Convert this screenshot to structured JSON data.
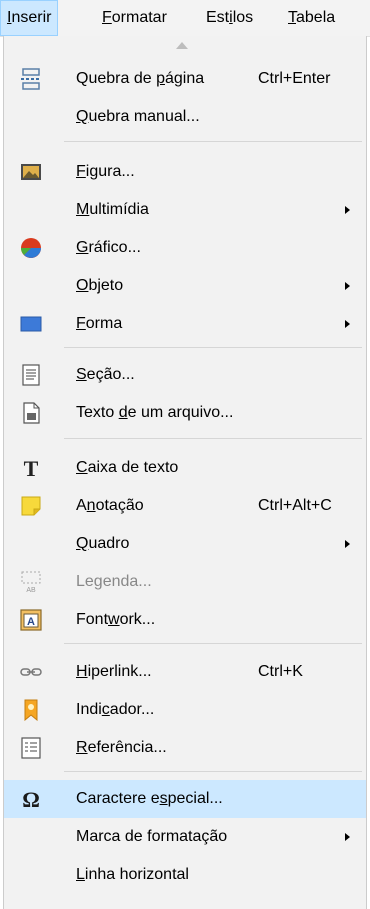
{
  "menubar": {
    "items": [
      {
        "pre": "",
        "u": "I",
        "post": "nserir",
        "active": true
      },
      {
        "pre": "",
        "u": "F",
        "post": "ormatar",
        "active": false
      },
      {
        "pre": "Est",
        "u": "i",
        "post": "los",
        "active": false
      },
      {
        "pre": "",
        "u": "T",
        "post": "abela",
        "active": false
      }
    ]
  },
  "menu": {
    "items": [
      {
        "pre": "Quebra de ",
        "u": "p",
        "post": "ágina",
        "shortcut": "Ctrl+Enter",
        "icon": "page-break-icon"
      },
      {
        "pre": "",
        "u": "Q",
        "post": "uebra manual...",
        "shortcut": "",
        "icon": ""
      },
      {
        "pre": "",
        "u": "F",
        "post": "igura...",
        "shortcut": "",
        "icon": "image-icon"
      },
      {
        "pre": "",
        "u": "M",
        "post": "ultimídia",
        "shortcut": "",
        "icon": "",
        "submenu": true
      },
      {
        "pre": "",
        "u": "G",
        "post": "ráfico...",
        "shortcut": "",
        "icon": "chart-icon"
      },
      {
        "pre": "",
        "u": "O",
        "post": "bjeto",
        "shortcut": "",
        "icon": "",
        "submenu": true
      },
      {
        "pre": "",
        "u": "F",
        "post": "orma",
        "shortcut": "",
        "icon": "shape-icon",
        "submenu": true
      },
      {
        "pre": "",
        "u": "S",
        "post": "eção...",
        "shortcut": "",
        "icon": "section-icon"
      },
      {
        "pre": "Texto ",
        "u": "d",
        "post": "e um arquivo...",
        "shortcut": "",
        "icon": "file-text-icon"
      },
      {
        "pre": "",
        "u": "C",
        "post": "aixa de texto",
        "shortcut": "",
        "icon": "text-box-icon"
      },
      {
        "pre": "A",
        "u": "n",
        "post": "otação",
        "shortcut": "Ctrl+Alt+C",
        "icon": "comment-icon"
      },
      {
        "pre": "",
        "u": "Q",
        "post": "uadro",
        "shortcut": "",
        "icon": "",
        "submenu": true
      },
      {
        "pre": "Le",
        "u": "g",
        "post": "enda...",
        "shortcut": "",
        "icon": "caption-icon",
        "disabled": true
      },
      {
        "pre": "Font",
        "u": "w",
        "post": "ork...",
        "shortcut": "",
        "icon": "fontwork-icon"
      },
      {
        "pre": "",
        "u": "H",
        "post": "iperlink...",
        "shortcut": "Ctrl+K",
        "icon": "hyperlink-icon"
      },
      {
        "pre": "Indi",
        "u": "c",
        "post": "ador...",
        "shortcut": "",
        "icon": "bookmark-icon"
      },
      {
        "pre": "",
        "u": "R",
        "post": "eferência...",
        "shortcut": "",
        "icon": "cross-reference-icon"
      },
      {
        "pre": "Caractere e",
        "u": "s",
        "post": "pecial...",
        "shortcut": "",
        "icon": "omega-icon",
        "highlighted": true
      },
      {
        "pre": "Marca de formatação",
        "u": "",
        "post": "",
        "shortcut": "",
        "icon": "",
        "submenu": true
      },
      {
        "pre": "",
        "u": "L",
        "post": "inha horizontal",
        "shortcut": "",
        "icon": ""
      }
    ]
  }
}
